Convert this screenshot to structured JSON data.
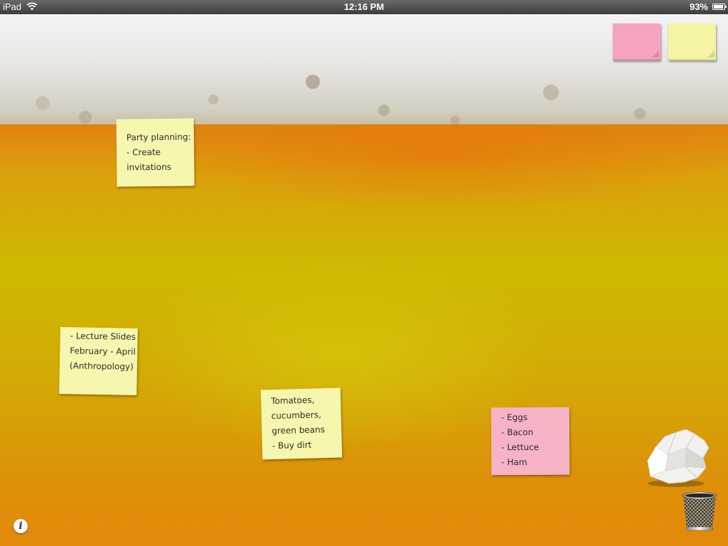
{
  "status_bar": {
    "device": "iPad",
    "time": "12:16 PM",
    "battery": "93%",
    "battery_level": 0.93,
    "wifi_icon": "wifi-icon",
    "battery_icon": "battery-icon"
  },
  "pads": {
    "pink_color": "#f6a3c2",
    "yellow_color": "#f5f4a2"
  },
  "notes": [
    {
      "color": "yellow",
      "lines": [
        "Party planning:",
        "- Create",
        "invitations"
      ]
    },
    {
      "color": "yellow",
      "lines": [
        "- Lecture Slides",
        "February - April",
        "(Anthropology)"
      ]
    },
    {
      "color": "yellow",
      "lines": [
        "Tomatoes,",
        "cucumbers,",
        "green beans",
        " - Buy dirt"
      ]
    },
    {
      "color": "pink",
      "lines": [
        "- Eggs",
        "- Bacon",
        "- Lettuce",
        "- Ham"
      ]
    }
  ],
  "icons": {
    "crumpled_paper": "crumpled-paper-icon",
    "trash": "trash-icon",
    "info": "info-icon"
  },
  "info_glyph": "i"
}
